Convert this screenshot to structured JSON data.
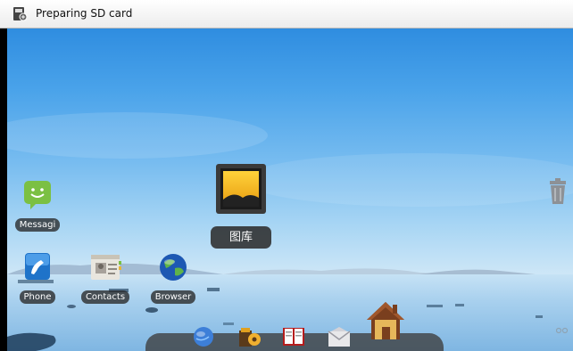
{
  "status_bar": {
    "notification_icon": "sd-card-icon",
    "text": "Preparing SD card"
  },
  "dragging_item": {
    "icon": "gallery-icon",
    "label": "图库"
  },
  "desktop_apps": [
    {
      "id": "messaging",
      "icon": "messaging-icon",
      "label": "Messagi"
    },
    {
      "id": "phone",
      "icon": "phone-icon",
      "label": "Phone"
    },
    {
      "id": "contacts",
      "icon": "contacts-icon",
      "label": "Contacts"
    },
    {
      "id": "browser",
      "icon": "browser-icon",
      "label": "Browser"
    }
  ],
  "trash": {
    "icon": "trash-icon"
  },
  "dock": {
    "items": [
      "globe-icon",
      "media-icon",
      "book-icon",
      "mail-icon",
      "home-icon"
    ]
  },
  "page_indicator": {
    "icon": "pages-indicator-icon"
  },
  "colors": {
    "sky_top": "#2f8de0",
    "horizon": "#cfe7f7",
    "label_bg": "#2d2d2d"
  }
}
